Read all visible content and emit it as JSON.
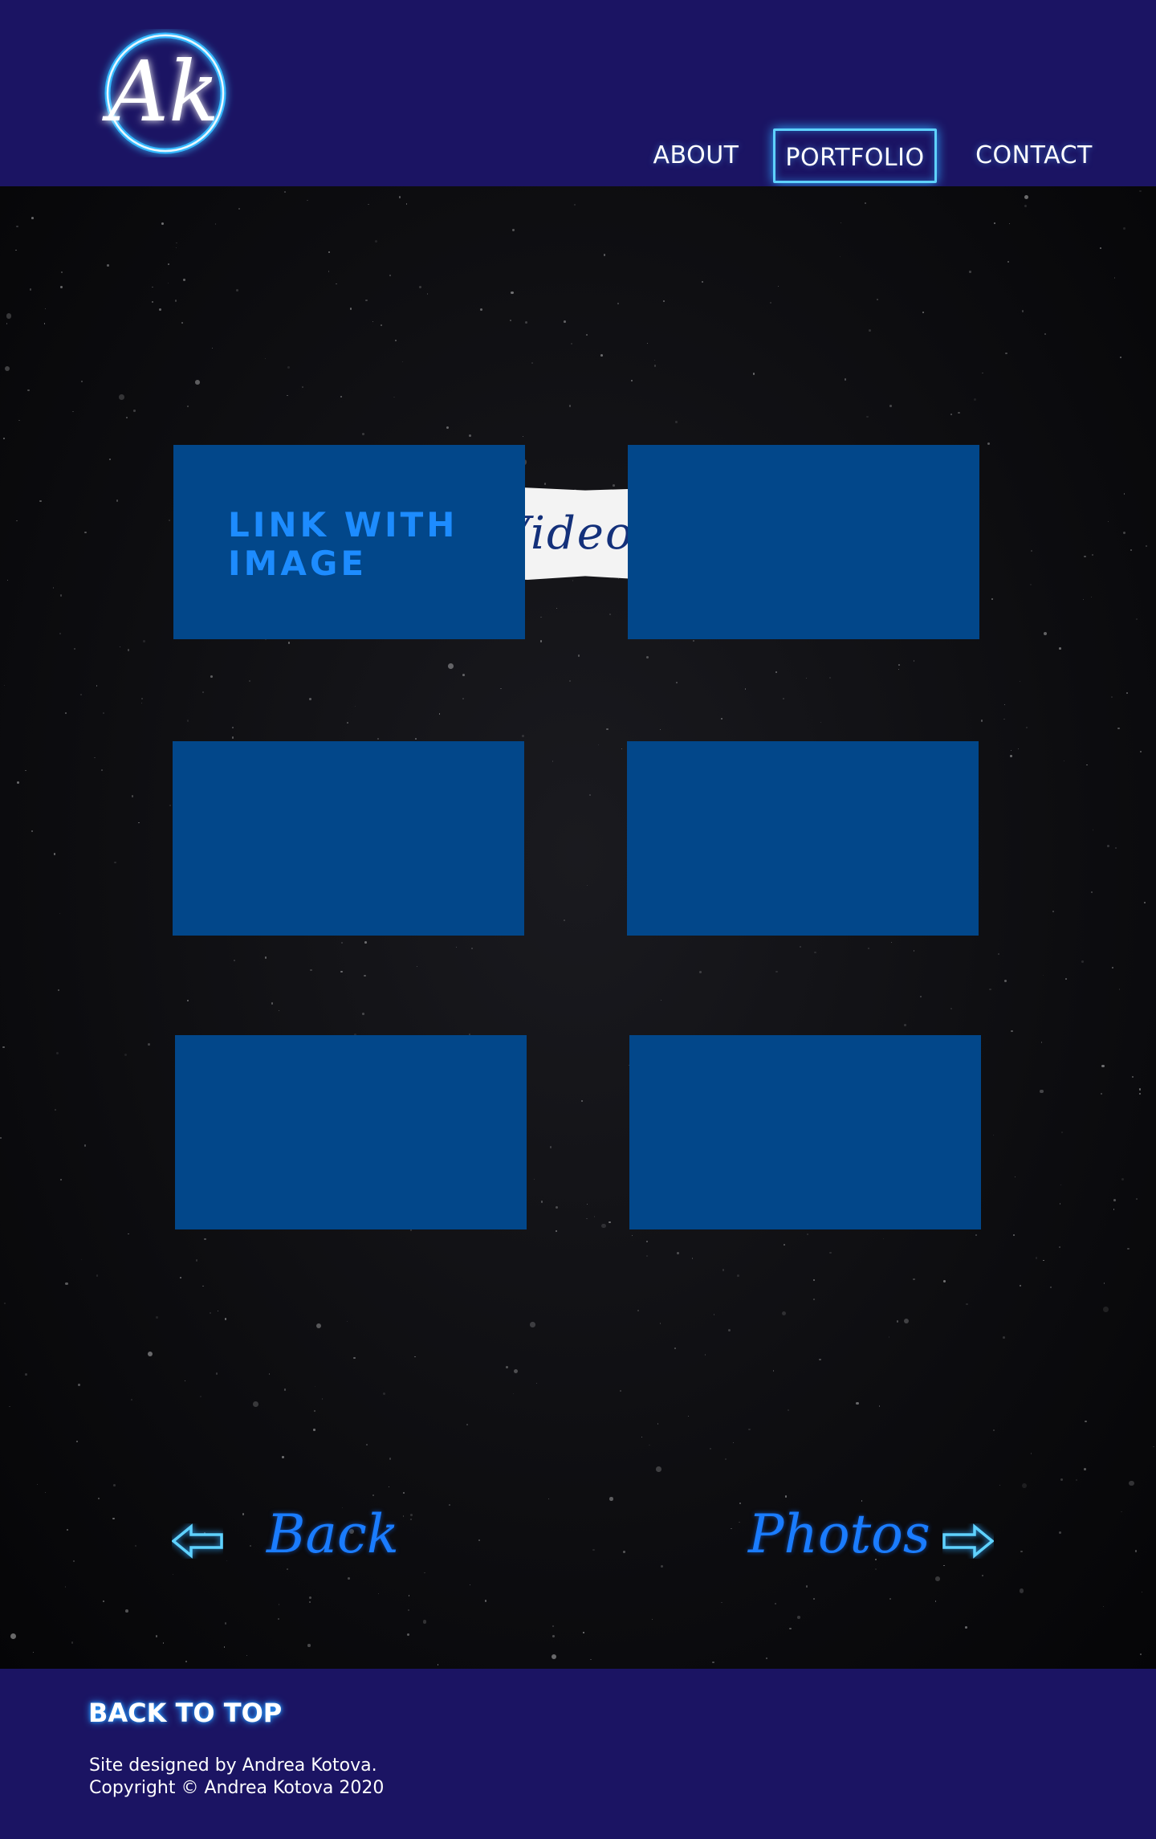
{
  "header": {
    "logo_text": "Ak",
    "nav": [
      "ABOUT",
      "PORTFOLIO",
      "CONTACT"
    ],
    "active_nav": "PORTFOLIO"
  },
  "main": {
    "section_title": "Videos",
    "tiles": [
      {
        "label": "LINK WITH IMAGE"
      },
      {
        "label": ""
      },
      {
        "label": ""
      },
      {
        "label": ""
      },
      {
        "label": ""
      },
      {
        "label": ""
      }
    ],
    "back_link": "Back",
    "next_link": "Photos"
  },
  "footer": {
    "back_to_top": "BACK TO TOP",
    "credit_line_1": "Site designed by Andrea Kotova.",
    "credit_line_2": "Copyright © Andrea Kotova 2020"
  },
  "colors": {
    "header_bg": "#1b1463",
    "tile_bg": "#02478a",
    "tile_text": "#1d8cff",
    "accent_glow": "#2fa9ff",
    "link_blue": "#1a7cff"
  },
  "icons": [
    "ak-logo-icon",
    "arrow-left-icon",
    "arrow-right-icon"
  ]
}
